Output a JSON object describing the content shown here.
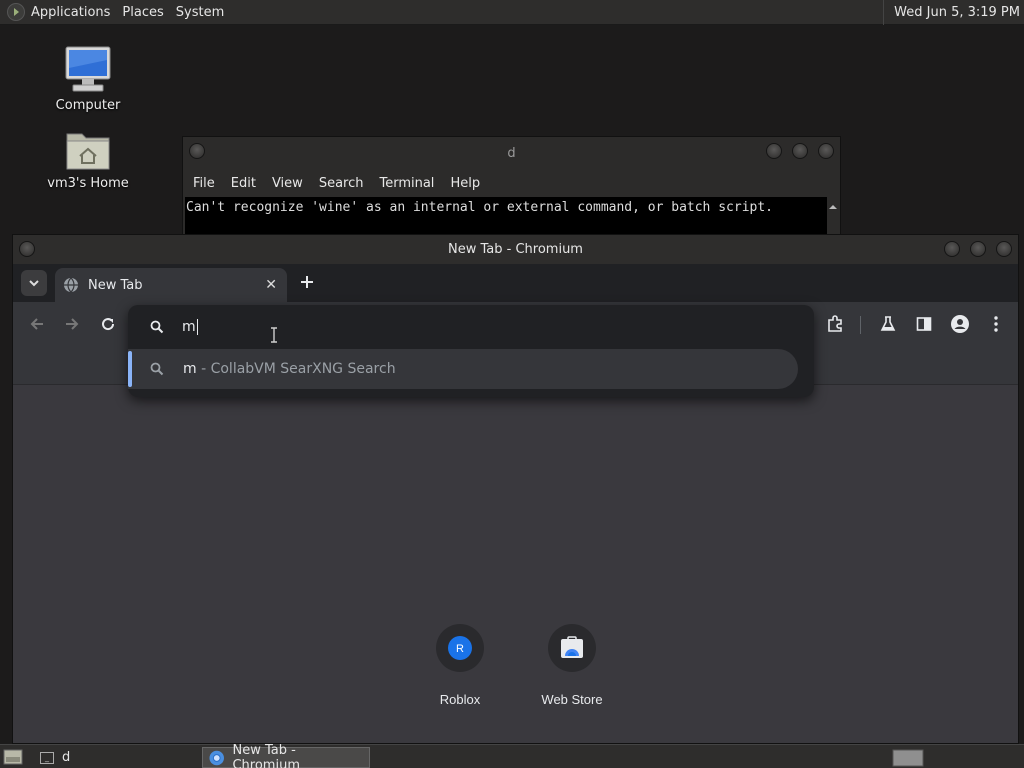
{
  "top_panel": {
    "menus": [
      "Applications",
      "Places",
      "System"
    ],
    "clock": "Wed Jun  5,  3:19 PM"
  },
  "desktop": {
    "icons": [
      {
        "label": "Computer"
      },
      {
        "label": "vm3's Home"
      }
    ]
  },
  "terminal": {
    "title": "d",
    "menus": [
      "File",
      "Edit",
      "View",
      "Search",
      "Terminal",
      "Help"
    ],
    "output": "Can't recognize 'wine' as an internal or external command, or batch script."
  },
  "chromium": {
    "title": "New Tab - Chromium",
    "tab_label": "New Tab",
    "omnibox": {
      "value": "m",
      "suggestion_query": "m",
      "suggestion_engine": " - CollabVM SearXNG Search"
    },
    "shortcuts": [
      {
        "label": "Roblox",
        "letter": "R"
      },
      {
        "label": "Web Store"
      }
    ]
  },
  "taskbar": {
    "tasks": [
      {
        "label": "d"
      },
      {
        "label": "New Tab - Chromium"
      }
    ]
  }
}
